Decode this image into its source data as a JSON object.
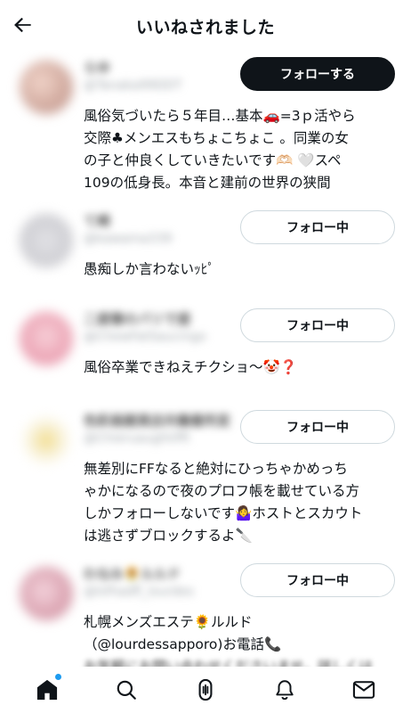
{
  "header": {
    "title": "いいねされました"
  },
  "users": [
    {
      "name": "らゆ",
      "handle": "@Tanaka99DDT",
      "follow_label": "フォローする",
      "avatar_color": "#d9b9b0",
      "bio_lines": [
        "風俗気づいたら５年目…基本🚗=3ｐ活やら",
        "交際♣メンエスもちょこちょこ 。同業の女",
        "の子と仲良くしていきたいです🫶🏻 🤍スペ",
        "109の低身長。本音と建前の世界の狭間"
      ]
    },
    {
      "name": "て崎",
      "handle": "@kawama339",
      "follow_label": "フォロー中",
      "avatar_color": "#d3d3d6",
      "bio_lines": [
        "愚痴しか言わないｯﾋﾟ"
      ]
    },
    {
      "name": "二度寝のバリで遊",
      "handle": "@ChewFatSaucingo",
      "follow_label": "フォロー中",
      "avatar_color": "#eea7b6",
      "bio_lines": [
        "風俗卒業できねえチクショ〜🤡❓"
      ]
    },
    {
      "name": "色彩画雑貨店共働番所変",
      "handle": "@Chieruaughtifft",
      "follow_label": "フォロー中",
      "avatar_color": "#f2e7b8",
      "bio_lines": [
        "無差別にFFなると絶対にひっちゃかめっち",
        "ゃかになるので夜のプロフ帳を載せている方",
        "しかフォローしないです🤷‍♀️ホストとスカウト",
        "は逃さずブロックするよ🔪"
      ]
    },
    {
      "name": "わなみ🌻ルルド",
      "handle": "@lsfhadfl_lourdes",
      "follow_label": "フォロー中",
      "avatar_color": "#d8a7b4",
      "bio_lines": [
        "札幌メンズエステ🌻ルルド",
        "（@lourdessapporo)お電話📞",
        "お気軽にお問い合わせくださいませ。詳しくは"
      ]
    }
  ],
  "nav": {
    "items": [
      "home-icon",
      "search-icon",
      "spaces-icon",
      "notifications-icon",
      "messages-icon"
    ],
    "dot_color": "#1d9bf0"
  }
}
